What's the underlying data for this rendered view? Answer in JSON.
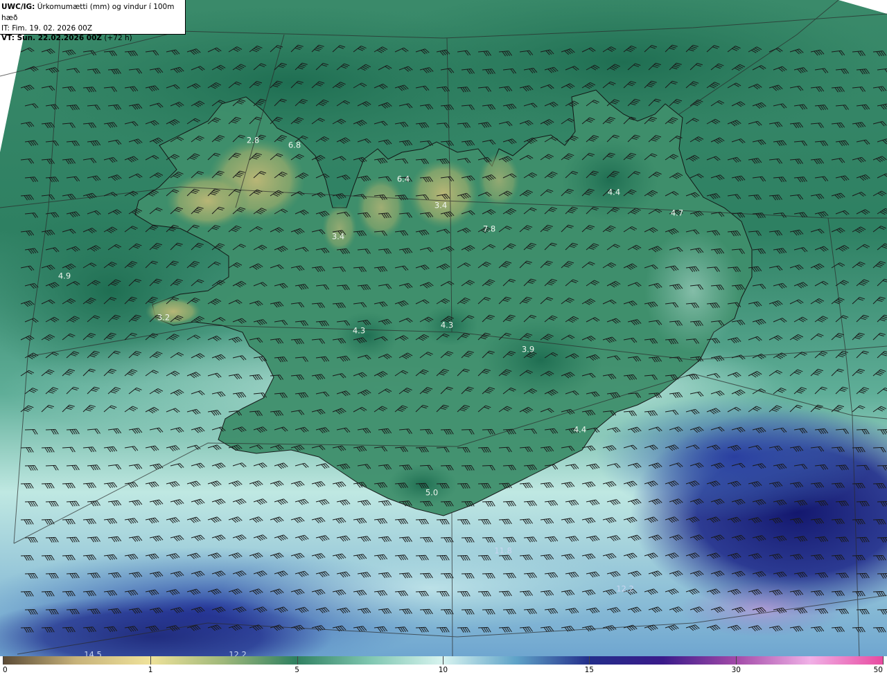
{
  "header": {
    "model": "UWC/IG:",
    "title": "Úrkomumætti (mm) og vindur í 100m hæð",
    "init_line": "IT: Fim. 19. 02. 2026 00Z",
    "valid_bold": "VT: Sun. 22.02.2026 00Z",
    "valid_lead": "(+72 h)"
  },
  "map_labels": [
    "2.8",
    "6.8",
    "6.4",
    "3.4",
    "7.8",
    "3.4",
    "4.4",
    "4.7",
    "4.9",
    "3.2",
    "4.3",
    "4.3",
    "3.9",
    "4.4",
    "5.0",
    "11.8",
    "12.2",
    "14.5",
    "12.2"
  ],
  "legend": {
    "ticks": [
      "0",
      "1",
      "5",
      "10",
      "15",
      "30",
      "50"
    ],
    "colors": [
      "#5a4a35",
      "#c7b27a",
      "#efe29a",
      "#9fb87a",
      "#2f8060",
      "#7fc6b0",
      "#d8f4f0",
      "#5fa3c8",
      "#232d8a",
      "#3a1a8a",
      "#a24aa8",
      "#f0b0e6",
      "#e84aa0"
    ]
  }
}
